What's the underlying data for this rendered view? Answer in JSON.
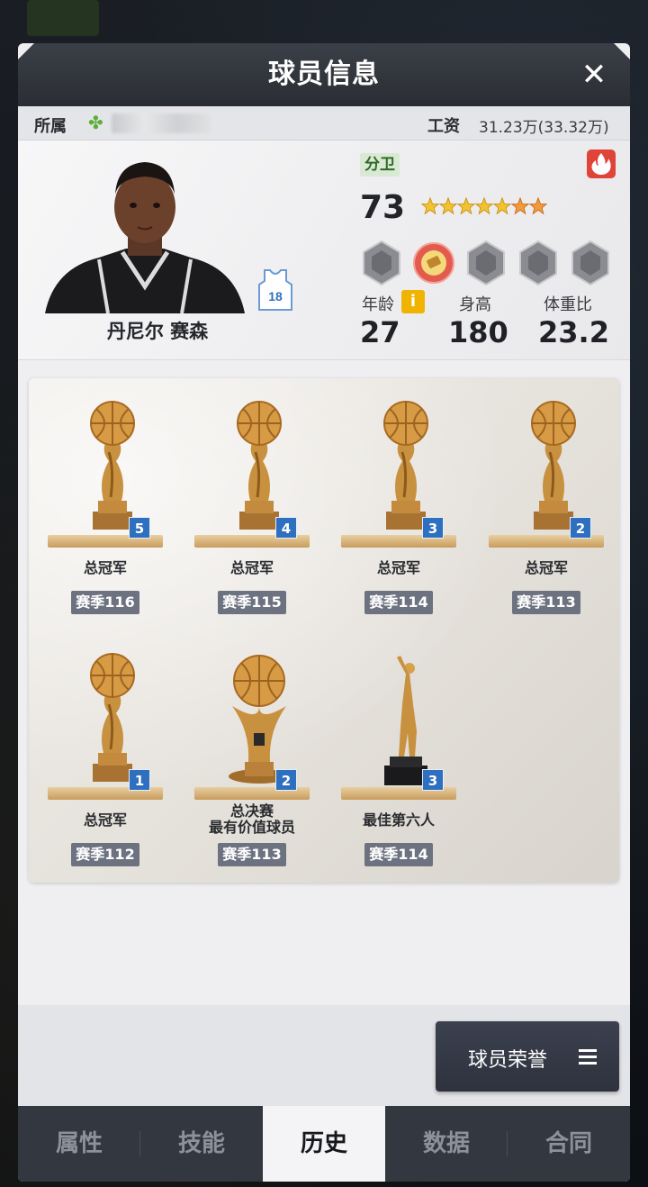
{
  "header": {
    "title": "球员信息"
  },
  "info_bar": {
    "affiliation_label": "所属",
    "salary_label": "工资",
    "salary_value": "31.23万(33.32万)"
  },
  "player": {
    "name": "丹尼尔 赛森",
    "jersey_number": "18",
    "position": "分卫",
    "overall": "73",
    "stars_filled": 5,
    "stars_total": 7,
    "stats": [
      {
        "label": "年龄",
        "value": "27"
      },
      {
        "label": "身高",
        "value": "180"
      },
      {
        "label": "体重比",
        "value": "23.2"
      }
    ]
  },
  "honors": [
    {
      "type": "trophy",
      "count": "5",
      "title": "总冠军",
      "season": "赛季116"
    },
    {
      "type": "trophy",
      "count": "4",
      "title": "总冠军",
      "season": "赛季115"
    },
    {
      "type": "trophy",
      "count": "3",
      "title": "总冠军",
      "season": "赛季114"
    },
    {
      "type": "trophy",
      "count": "2",
      "title": "总冠军",
      "season": "赛季113"
    },
    {
      "type": "trophy",
      "count": "1",
      "title": "总冠军",
      "season": "赛季112"
    },
    {
      "type": "trophy-mvp",
      "count": "2",
      "title": "总决赛\n最有价值球员",
      "season": "赛季113"
    },
    {
      "type": "statue",
      "count": "3",
      "title": "最佳第六人",
      "season": "赛季114"
    }
  ],
  "footer": {
    "honor_button_label": "球员荣誉"
  },
  "tabs": [
    {
      "label": "属性",
      "active": false
    },
    {
      "label": "技能",
      "active": false
    },
    {
      "label": "历史",
      "active": true
    },
    {
      "label": "数据",
      "active": false
    },
    {
      "label": "合同",
      "active": false
    }
  ],
  "colors": {
    "accent_blue": "#2f6fbf",
    "gold": "#c8913f",
    "tab_active": "#f4f4f6",
    "header": "#2a2d33"
  },
  "icons": [
    "close-icon",
    "clover-icon",
    "fire-icon",
    "info-icon",
    "jersey-icon",
    "menu-icon",
    "badge-icon"
  ]
}
